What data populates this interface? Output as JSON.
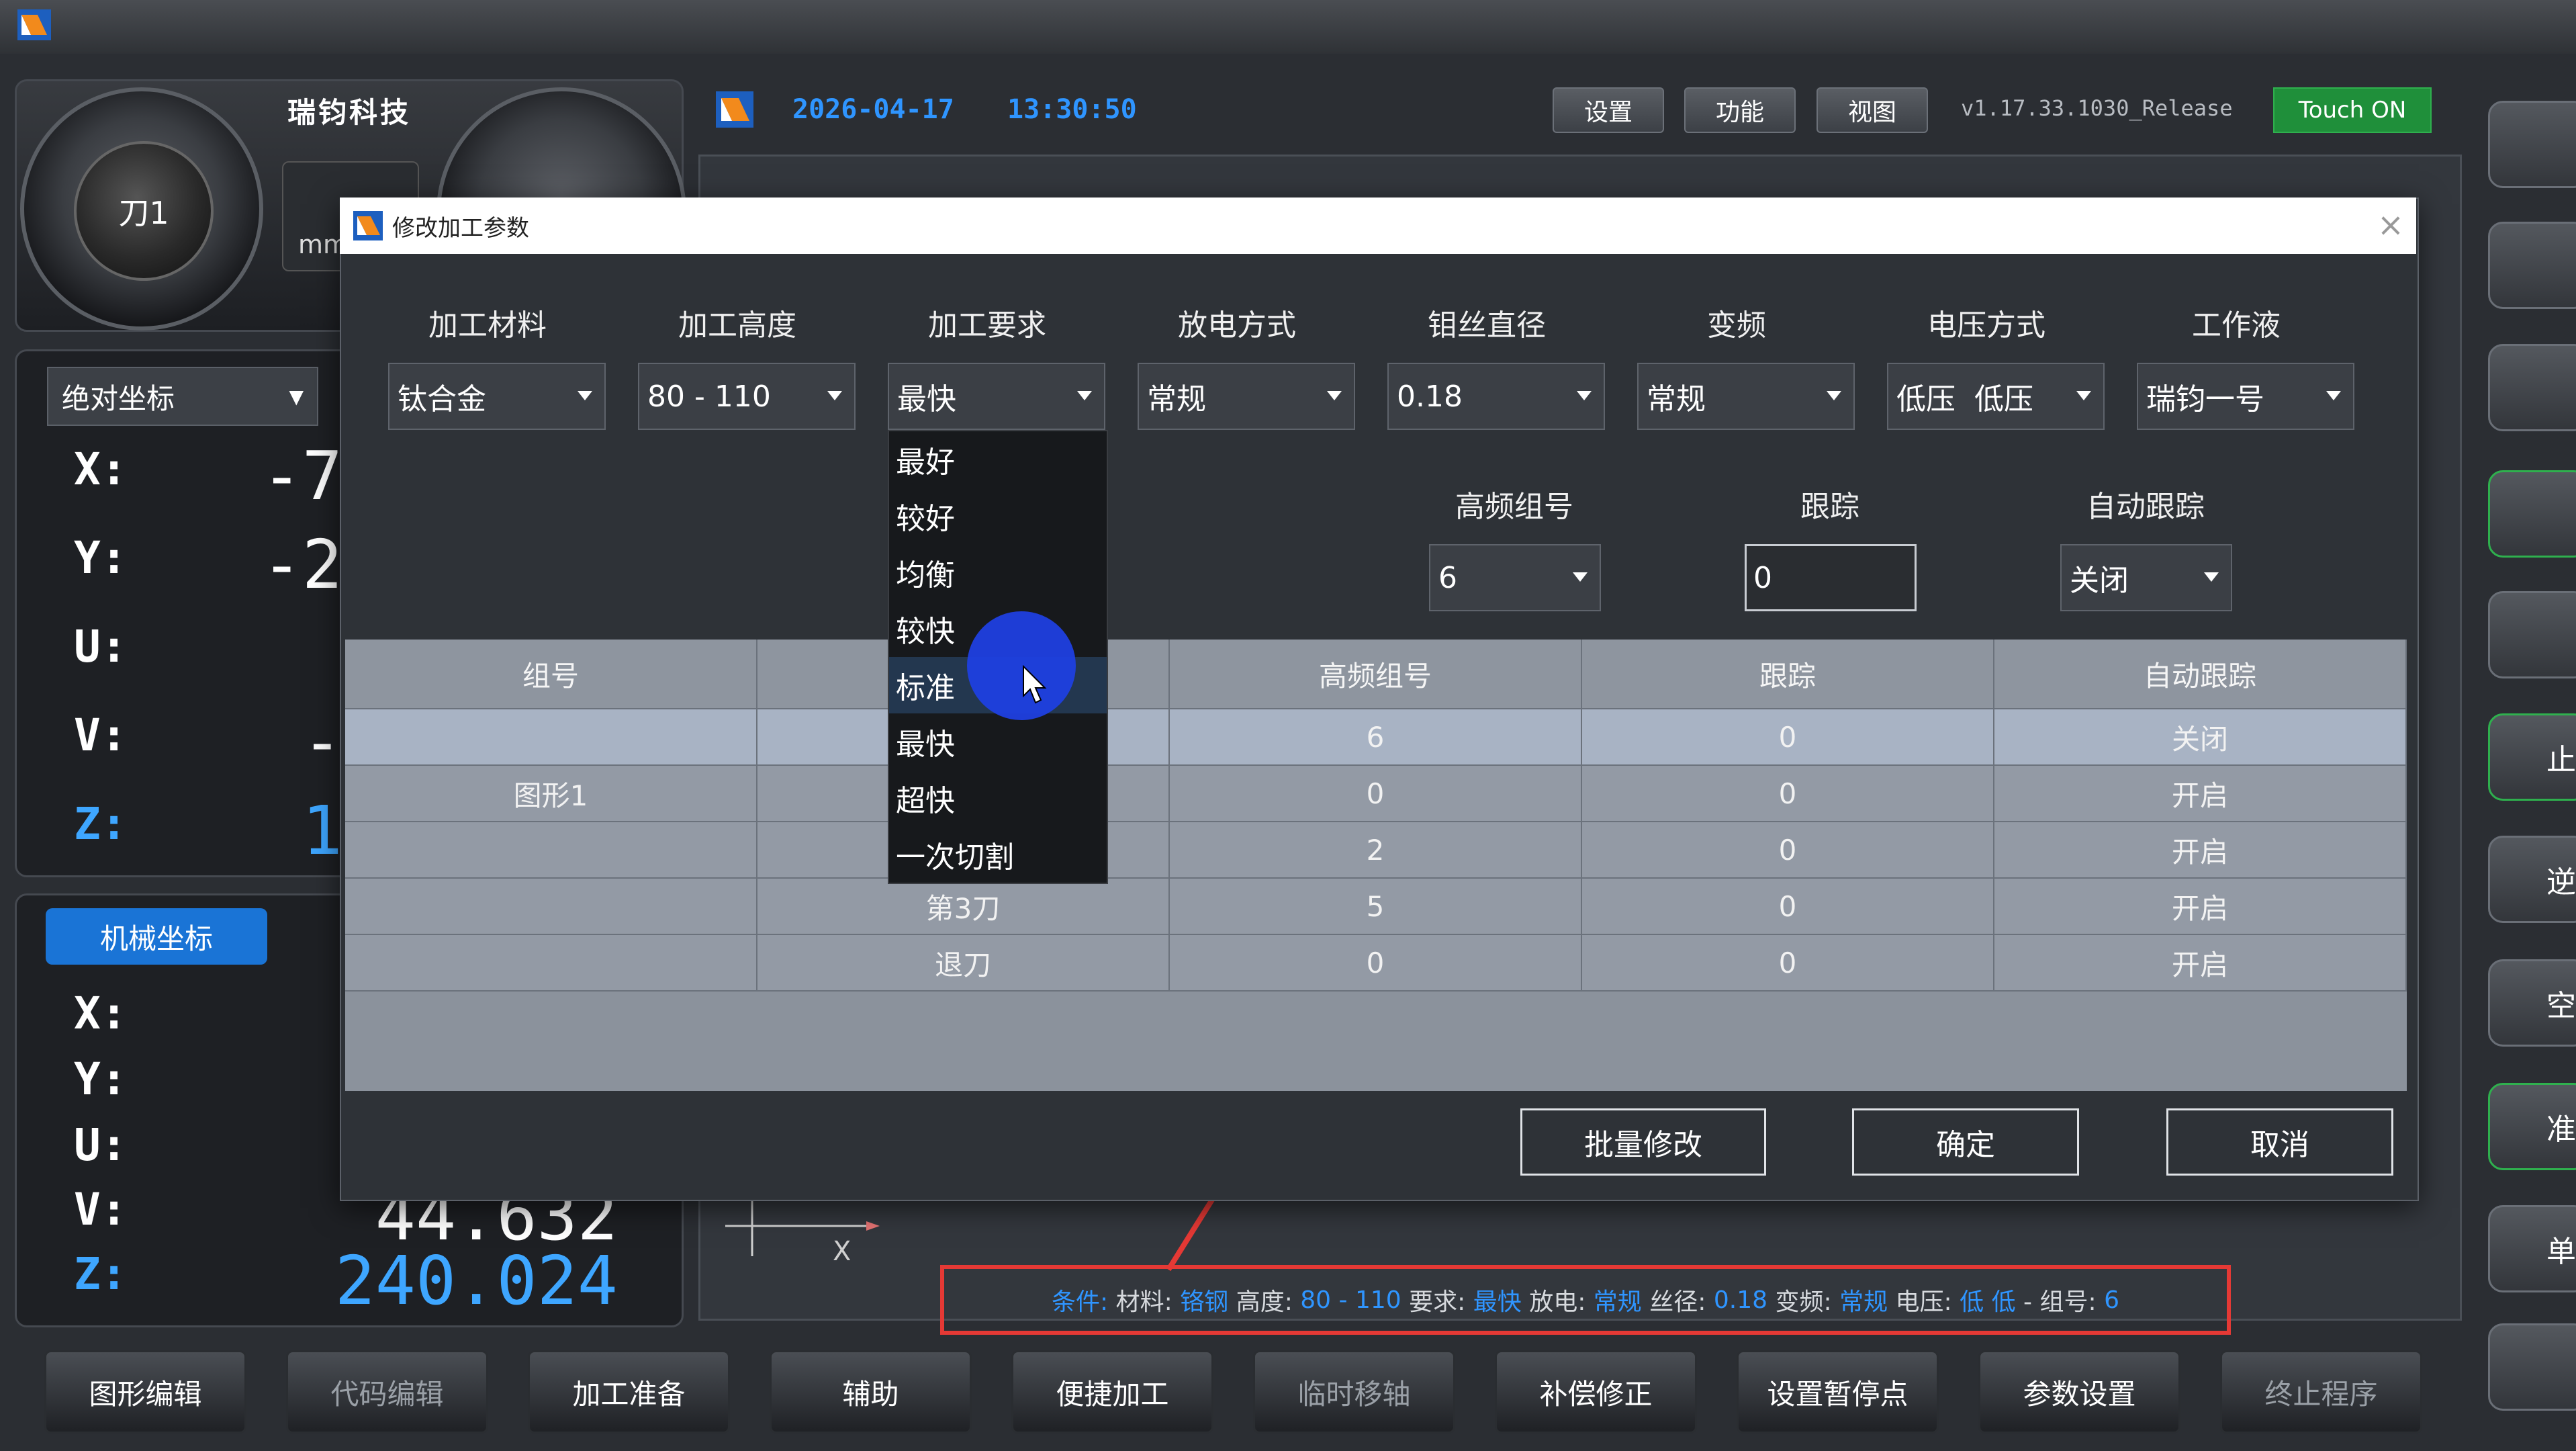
{
  "header": {
    "date": "2026-04-17",
    "time": "13:30:50",
    "buttons": [
      "设置",
      "功能",
      "视图"
    ],
    "version": "v1.17.33.1030_Release",
    "touch_label": "Touch ON"
  },
  "left_panel": {
    "company": "瑞钧科技",
    "tool_label": "刀1",
    "unit": "mm",
    "coord_mode": "绝对坐标",
    "axes": [
      "X:",
      "Y:",
      "U:",
      "V:",
      "Z:"
    ],
    "abs_values_partial": [
      "-7",
      "-2",
      "",
      "-",
      "1"
    ],
    "mech_tab": "机械坐标",
    "mech_values_visible": [
      "",
      "",
      "",
      "44.632",
      "240.024"
    ]
  },
  "dialog": {
    "title": "修改加工参数",
    "labels": [
      "加工材料",
      "加工高度",
      "加工要求",
      "放电方式",
      "钼丝直径",
      "变频",
      "电压方式",
      "工作液"
    ],
    "values": [
      "钛合金",
      "80 - 110",
      "最快",
      "常规",
      "0.18",
      "常规",
      "低压  低压",
      "瑞钧一号"
    ],
    "row2_labels": [
      "高频组号",
      "跟踪",
      "自动跟踪"
    ],
    "row2_values": {
      "hf_group": "6",
      "tracking": "0",
      "auto_tracking": "关闭"
    },
    "dropdown_options": [
      "最好",
      "较好",
      "均衡",
      "较快",
      "标准",
      "最快",
      "超快",
      "一次切割"
    ],
    "dropdown_hover_index": 4,
    "table": {
      "headers": [
        "组号",
        "",
        "高频组号",
        "跟踪",
        "自动跟踪"
      ],
      "rows": [
        [
          "",
          "",
          "6",
          "0",
          "关闭"
        ],
        [
          "图形1",
          "",
          "0",
          "0",
          "开启"
        ],
        [
          "",
          "",
          "2",
          "0",
          "开启"
        ],
        [
          "",
          "第3刀",
          "5",
          "0",
          "开启"
        ],
        [
          "",
          "退刀",
          "0",
          "0",
          "开启"
        ]
      ]
    },
    "buttons": {
      "batch": "批量修改",
      "ok": "确定",
      "cancel": "取消"
    }
  },
  "status": {
    "condition_label": "条件:",
    "material_label": "材料:",
    "material": "铬钢",
    "height_label": "高度:",
    "height": "80 - 110",
    "req_label": "要求:",
    "req": "最快",
    "discharge_label": "放电:",
    "discharge": "常规",
    "wire_label": "丝径:",
    "wire": "0.18",
    "freq_label": "变频:",
    "freq": "常规",
    "voltage_label": "电压:",
    "voltage": "低 低",
    "group_label": "- 组号:",
    "group": "6"
  },
  "mini_axis_label": "X",
  "bottom_toolbar": [
    "图形编辑",
    "代码编辑",
    "加工准备",
    "辅助",
    "便捷加工",
    "临时移轴",
    "补偿修正",
    "设置暂停点",
    "参数设置",
    "终止程序"
  ],
  "side_buttons": [
    "",
    "",
    "",
    "",
    "",
    "止",
    "逆",
    "空",
    "准",
    "单",
    ""
  ],
  "colors": {
    "accent_blue": "#2f95ff",
    "annotation_red": "#e53935",
    "touch_green": "#1f8f3a"
  }
}
